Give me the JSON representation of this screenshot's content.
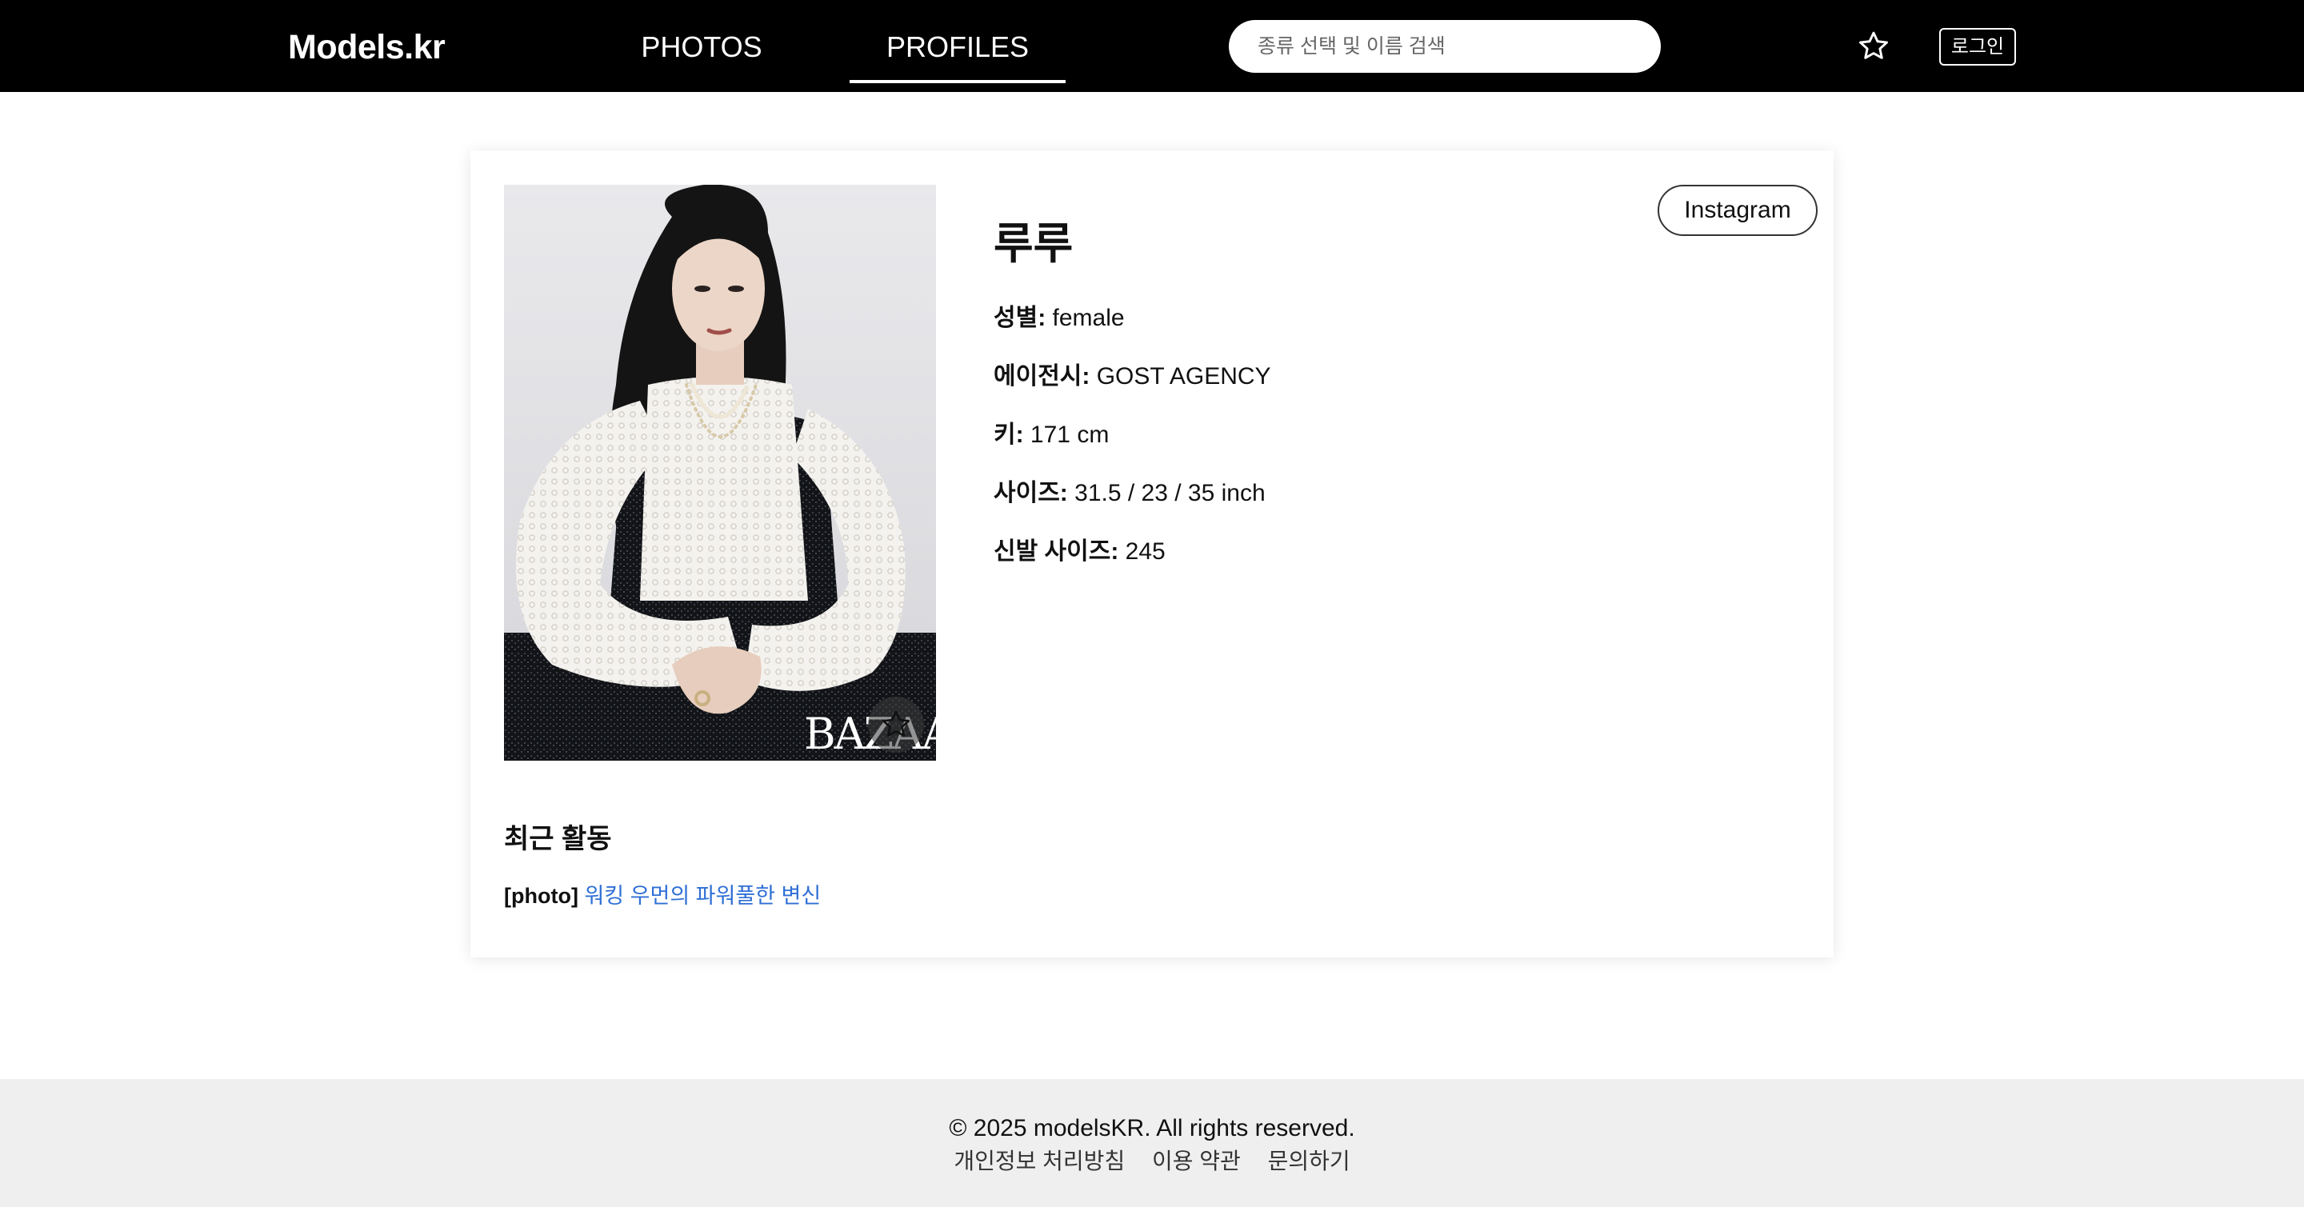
{
  "header": {
    "logo": "Models.kr",
    "tabs": [
      {
        "label": "PHOTOS",
        "active": false
      },
      {
        "label": "PROFILES",
        "active": true
      }
    ],
    "search_placeholder": "종류 선택 및 이름 검색",
    "favorites_icon": "star-outline-icon",
    "login_label": "로그인"
  },
  "profile": {
    "name": "루루",
    "instagram_label": "Instagram",
    "photo_watermark": "BAZAAR",
    "fields": [
      {
        "label": "성별:",
        "value": " female"
      },
      {
        "label": "에이전시:",
        "value": " GOST AGENCY"
      },
      {
        "label": "키:",
        "value": " 171 cm"
      },
      {
        "label": "사이즈:",
        "value": " 31.5 / 23 / 35 inch"
      },
      {
        "label": "신발 사이즈:",
        "value": " 245"
      }
    ]
  },
  "recent": {
    "title": "최근 활동",
    "items": [
      {
        "tag": "[photo]",
        "text": "워킹 우먼의 파워풀한 변신"
      }
    ]
  },
  "footer": {
    "copyright": "© 2025 modelsKR. All rights reserved.",
    "links": [
      "개인정보 처리방침",
      "이용 약관",
      "문의하기"
    ]
  },
  "colors": {
    "header_bg": "#000000",
    "link": "#2f6fd6",
    "footer_bg": "#efefef"
  }
}
